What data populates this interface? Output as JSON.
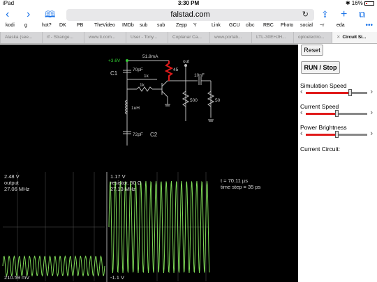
{
  "status_bar": {
    "carrier": "iPad",
    "time": "3:30 PM",
    "battery": "16%"
  },
  "toolbar": {
    "url": "falstad.com"
  },
  "bookmarks": [
    "kodi",
    "g",
    "hot?",
    "DK",
    "PB",
    "TheVideo",
    "IMDb",
    "sub",
    "sub",
    "Zepp",
    "Y",
    "Link",
    "GCU",
    "cibc",
    "RBC",
    "Photo",
    "social",
    "~r",
    "eda"
  ],
  "tabs": [
    {
      "label": "Alaska (see...",
      "active": false
    },
    {
      "label": "rf - Strange...",
      "active": false
    },
    {
      "label": "www.ti.com...",
      "active": false
    },
    {
      "label": "User - Tony...",
      "active": false
    },
    {
      "label": "Coplanar Ca...",
      "active": false
    },
    {
      "label": "www.portab...",
      "active": false
    },
    {
      "label": "LTL-30EHJH...",
      "active": false
    },
    {
      "label": "optoelectro...",
      "active": false
    },
    {
      "label": "Circuit Si...",
      "active": true
    }
  ],
  "circuit": {
    "supply": "+3.6V",
    "current": "51.8mA",
    "c1_name": "C1",
    "c1_value": "70pF",
    "r1": "45",
    "r2": "1k",
    "r3": "1k",
    "inductor": "1uH",
    "c2_name": "C2",
    "c2_value": "72pF",
    "out_label": "out",
    "c_out": "10nF",
    "r_load1": "500",
    "r_load2": "50"
  },
  "scope1": {
    "top_voltage": "2.48 V",
    "name": "output",
    "freq": "27.06 MHz",
    "bottom": "210.59 mV"
  },
  "scope2": {
    "top_voltage": "1.17 V",
    "name": "resistor, 50 Ω",
    "freq": "27.13 MHz",
    "bottom": "-1.1 V"
  },
  "sim_info": {
    "time": "t = 70.11 µs",
    "step": "time step = 35 ps"
  },
  "panel": {
    "reset": "Reset",
    "run_stop": "RUN / Stop",
    "sim_speed": "Simulation Speed",
    "sim_speed_level": 0.72,
    "current_speed": "Current Speed",
    "current_speed_level": 0.5,
    "power_brightness": "Power Brightness",
    "power_brightness_level": 0.5,
    "current_circuit": "Current Circuit:"
  },
  "colors": {
    "accent": "#1a73e8",
    "wire": "#c0c0c0",
    "wave": "#7ed957",
    "active_component": "#e01b1b",
    "supply": "#32cd32"
  }
}
